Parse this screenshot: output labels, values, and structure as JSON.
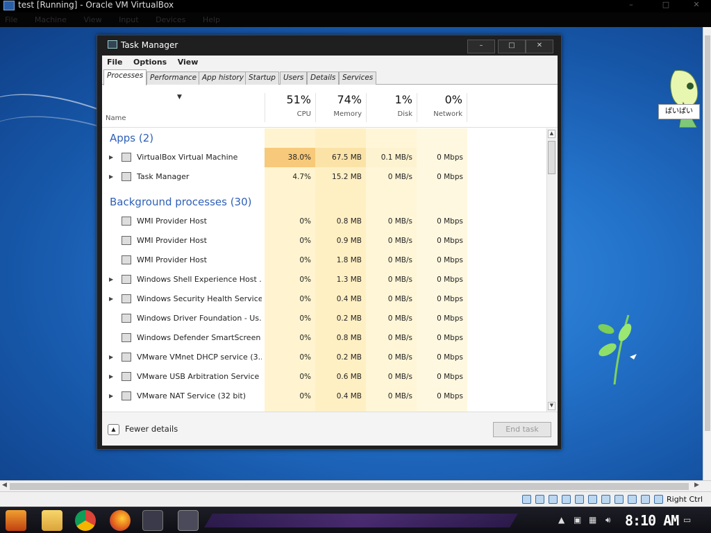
{
  "host": {
    "title": "test [Running] - Oracle VM VirtualBox",
    "menu": [
      "File",
      "Machine",
      "View",
      "Input",
      "Devices",
      "Help"
    ],
    "controls": [
      "–",
      "□",
      "✕"
    ],
    "status_host_key": "Right Ctrl"
  },
  "desktop": {
    "speech_text": "ぱいぱい"
  },
  "taskmanager": {
    "title": "Task Manager",
    "window_controls": [
      "–",
      "□",
      "✕"
    ],
    "menu": [
      "File",
      "Options",
      "View"
    ],
    "tabs": [
      "Processes",
      "Performance",
      "App history",
      "Startup",
      "Users",
      "Details",
      "Services"
    ],
    "active_tab": "Processes",
    "columns": {
      "name": "Name",
      "cpu": {
        "pct": "51%",
        "label": "CPU"
      },
      "memory": {
        "pct": "74%",
        "label": "Memory"
      },
      "disk": {
        "pct": "1%",
        "label": "Disk"
      },
      "network": {
        "pct": "0%",
        "label": "Network"
      }
    },
    "apps_group": "Apps (2)",
    "apps": [
      {
        "name": "VirtualBox Virtual Machine",
        "cpu": "38.0%",
        "memory": "67.5 MB",
        "disk": "0.1 MB/s",
        "network": "0 Mbps",
        "expandable": true
      },
      {
        "name": "Task Manager",
        "cpu": "4.7%",
        "memory": "15.2 MB",
        "disk": "0 MB/s",
        "network": "0 Mbps",
        "expandable": true
      }
    ],
    "bg_group": "Background processes (30)",
    "background": [
      {
        "name": "WMI Provider Host",
        "cpu": "0%",
        "memory": "0.8 MB",
        "disk": "0 MB/s",
        "network": "0 Mbps",
        "expandable": false
      },
      {
        "name": "WMI Provider Host",
        "cpu": "0%",
        "memory": "0.9 MB",
        "disk": "0 MB/s",
        "network": "0 Mbps",
        "expandable": false
      },
      {
        "name": "WMI Provider Host",
        "cpu": "0%",
        "memory": "1.8 MB",
        "disk": "0 MB/s",
        "network": "0 Mbps",
        "expandable": false
      },
      {
        "name": "Windows Shell Experience Host ...",
        "cpu": "0%",
        "memory": "1.3 MB",
        "disk": "0 MB/s",
        "network": "0 Mbps",
        "expandable": true
      },
      {
        "name": "Windows Security Health Service",
        "cpu": "0%",
        "memory": "0.4 MB",
        "disk": "0 MB/s",
        "network": "0 Mbps",
        "expandable": true
      },
      {
        "name": "Windows Driver Foundation - Us...",
        "cpu": "0%",
        "memory": "0.2 MB",
        "disk": "0 MB/s",
        "network": "0 Mbps",
        "expandable": false
      },
      {
        "name": "Windows Defender SmartScreen",
        "cpu": "0%",
        "memory": "0.8 MB",
        "disk": "0 MB/s",
        "network": "0 Mbps",
        "expandable": false
      },
      {
        "name": "VMware VMnet DHCP service (3...",
        "cpu": "0%",
        "memory": "0.2 MB",
        "disk": "0 MB/s",
        "network": "0 Mbps",
        "expandable": true
      },
      {
        "name": "VMware USB Arbitration Service",
        "cpu": "0%",
        "memory": "0.6 MB",
        "disk": "0 MB/s",
        "network": "0 Mbps",
        "expandable": true
      },
      {
        "name": "VMware NAT Service (32 bit)",
        "cpu": "0%",
        "memory": "0.4 MB",
        "disk": "0 MB/s",
        "network": "0 Mbps",
        "expandable": true
      }
    ],
    "fewer_details": "Fewer details",
    "end_task": "End task"
  },
  "taskbar": {
    "clock": "8:10 AM",
    "pinned": [
      "start-icon",
      "file-explorer-icon",
      "chrome-icon",
      "firefox-icon",
      "calculator-icon",
      "task-manager-icon"
    ]
  },
  "colors": {
    "cpu_high": "#f7c97a",
    "cpu_mid": "#fbe3a8",
    "col_bg": "#fdf3d0",
    "group_blue": "#2d5fb8"
  }
}
